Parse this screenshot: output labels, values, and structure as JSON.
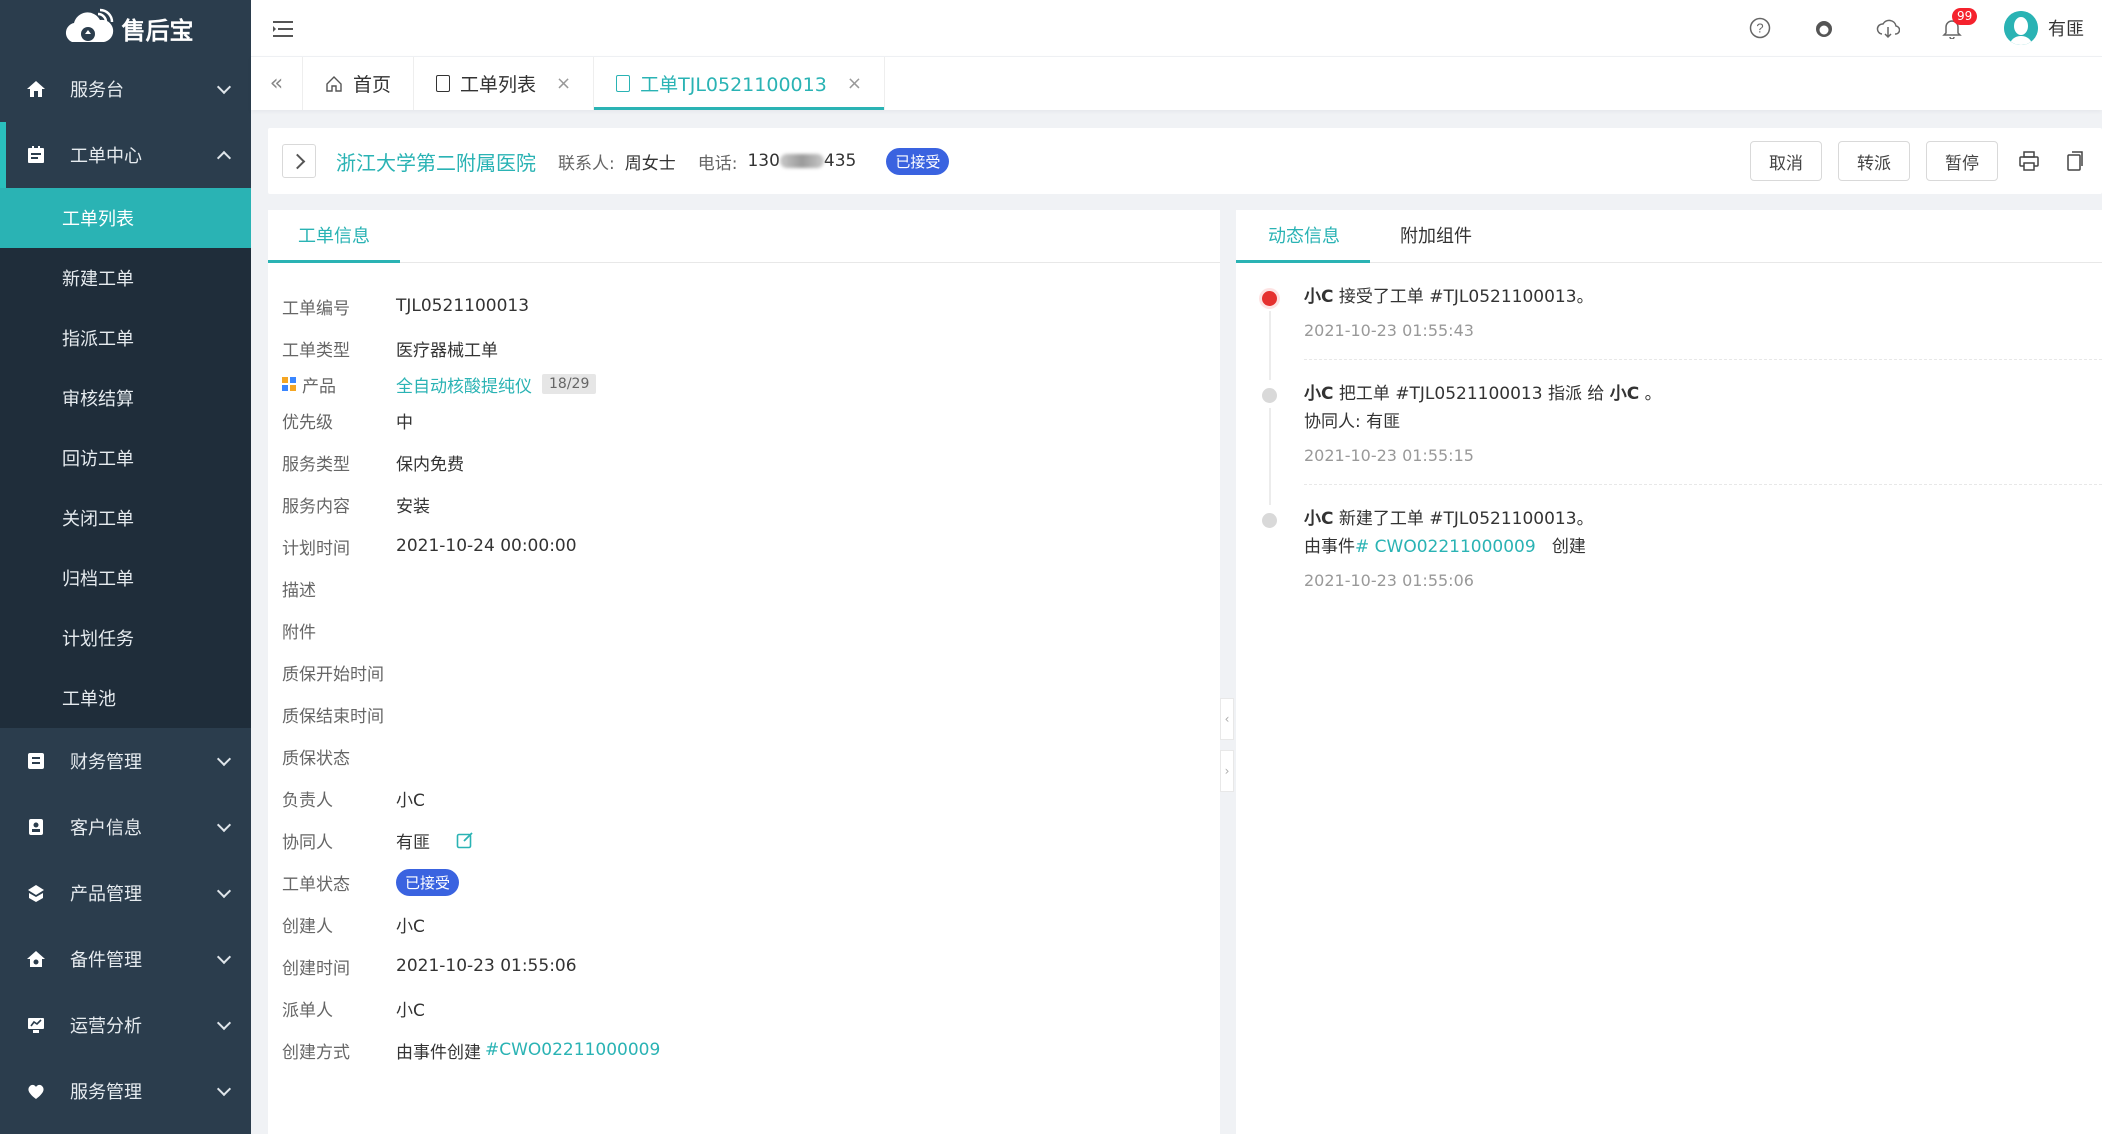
{
  "app": {
    "brand": "售后宝"
  },
  "sidebar": {
    "top_items": [
      {
        "label": "服务台",
        "icon": "home-icon"
      }
    ],
    "open_item": {
      "label": "工单中心",
      "icon": "ticket-icon"
    },
    "sub_items": [
      "工单列表",
      "新建工单",
      "指派工单",
      "审核结算",
      "回访工单",
      "关闭工单",
      "归档工单",
      "计划任务",
      "工单池"
    ],
    "bottom_items": [
      {
        "label": "财务管理",
        "icon": "finance-icon"
      },
      {
        "label": "客户信息",
        "icon": "customer-icon"
      },
      {
        "label": "产品管理",
        "icon": "product-icon"
      },
      {
        "label": "备件管理",
        "icon": "parts-icon"
      },
      {
        "label": "运营分析",
        "icon": "analytics-icon"
      },
      {
        "label": "服务管理",
        "icon": "service-icon"
      }
    ]
  },
  "topbar": {
    "notification_count": "99",
    "user_name": "有匪"
  },
  "tabs": [
    {
      "label": "首页"
    },
    {
      "label": "工单列表"
    },
    {
      "label": "工单TJL0521100013"
    }
  ],
  "header": {
    "hospital": "浙江大学第二附属医院",
    "contact_label": "联系人:",
    "contact_name": "周女士",
    "phone_label": "电话:",
    "phone_prefix": "130",
    "phone_suffix": "435",
    "status": "已接受",
    "buttons": [
      "取消",
      "转派",
      "暂停"
    ]
  },
  "left_panel": {
    "tab": "工单信息",
    "fields": {
      "order_no": {
        "label": "工单编号",
        "value": "TJL0521100013"
      },
      "order_type": {
        "label": "工单类型",
        "value": "医疗器械工单"
      },
      "product": {
        "label": "产品",
        "value": "全自动核酸提纯仪",
        "tag": "18/29"
      },
      "priority": {
        "label": "优先级",
        "value": "中"
      },
      "service_type": {
        "label": "服务类型",
        "value": "保内免费"
      },
      "service_content": {
        "label": "服务内容",
        "value": "安装"
      },
      "plan_time": {
        "label": "计划时间",
        "value": "2021-10-24 00:00:00"
      },
      "description": {
        "label": "描述",
        "value": ""
      },
      "attachment": {
        "label": "附件",
        "value": ""
      },
      "warranty_start": {
        "label": "质保开始时间",
        "value": ""
      },
      "warranty_end": {
        "label": "质保结束时间",
        "value": ""
      },
      "warranty_status": {
        "label": "质保状态",
        "value": ""
      },
      "owner": {
        "label": "负责人",
        "value": "小C"
      },
      "collaborator": {
        "label": "协同人",
        "value": "有匪"
      },
      "status": {
        "label": "工单状态",
        "value": "已接受"
      },
      "creator": {
        "label": "创建人",
        "value": "小C"
      },
      "created_at": {
        "label": "创建时间",
        "value": "2021-10-23 01:55:06"
      },
      "dispatcher": {
        "label": "派单人",
        "value": "小C"
      },
      "create_method": {
        "label": "创建方式",
        "value": "由事件创建",
        "link": "#CWO02211000009"
      }
    }
  },
  "right_panel": {
    "tabs": [
      "动态信息",
      "附加组件"
    ],
    "timeline": [
      {
        "actor": "小C",
        "text": " 接受了工单 #TJL0521100013。",
        "time": "2021-10-23 01:55:43"
      },
      {
        "actor": "小C",
        "text": " 把工单 #TJL0521100013 指派 给 ",
        "target": "小C",
        "tail": " 。",
        "sub": "协同人: 有匪",
        "time": "2021-10-23 01:55:15"
      },
      {
        "actor": "小C",
        "text": " 新建了工单 #TJL0521100013。",
        "sub_prefix": "由事件",
        "sub_link": "# CWO02211000009",
        "sub_suffix": "创建",
        "time": "2021-10-23 01:55:06"
      }
    ]
  }
}
